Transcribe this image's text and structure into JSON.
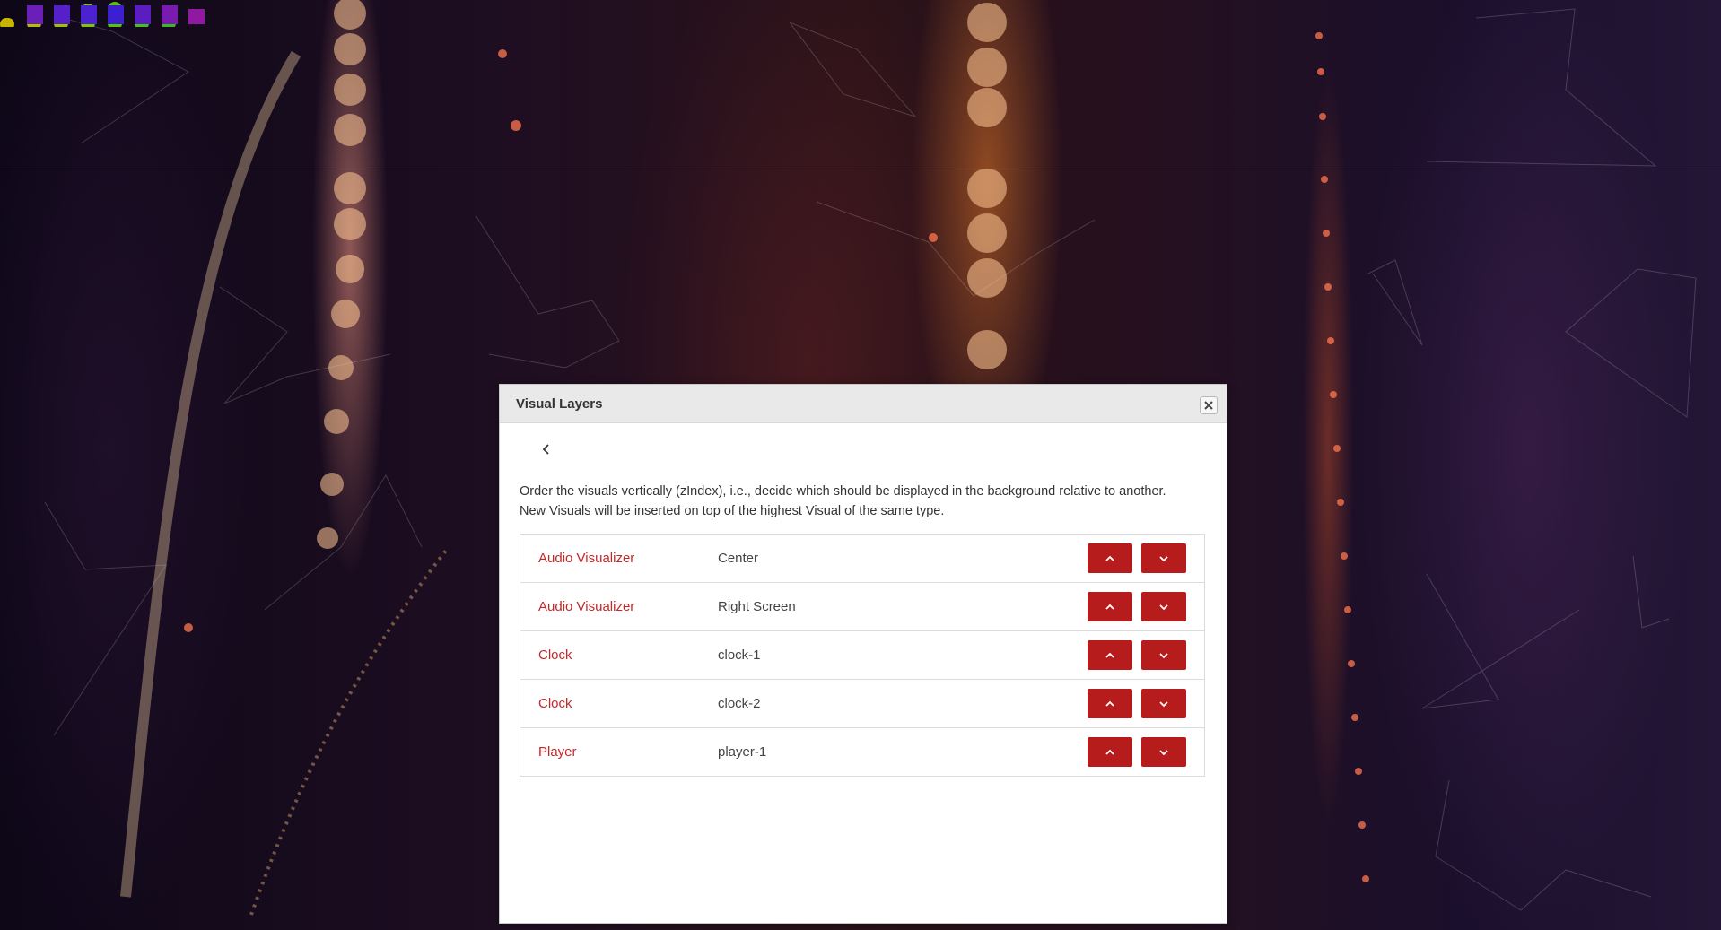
{
  "dialog": {
    "title": "Visual Layers",
    "description": "Order the visuals vertically (zIndex), i.e., decide which should be displayed in the background relative to another.",
    "description_line2": "New Visuals will be inserted on top of the highest Visual of the same type."
  },
  "layers": [
    {
      "type": "Audio Visualizer",
      "name": "Center"
    },
    {
      "type": "Audio Visualizer",
      "name": "Right Screen"
    },
    {
      "type": "Clock",
      "name": "clock-1"
    },
    {
      "type": "Clock",
      "name": "clock-2"
    },
    {
      "type": "Player",
      "name": "player-1"
    }
  ],
  "colors": {
    "accent": "#b71c1c",
    "type_text": "#c62828",
    "titlebar": "#e9e9e9"
  },
  "icons": {
    "close": "close-icon",
    "back": "chevron-left-icon",
    "up": "chevron-up-icon",
    "down": "chevron-down-icon"
  }
}
